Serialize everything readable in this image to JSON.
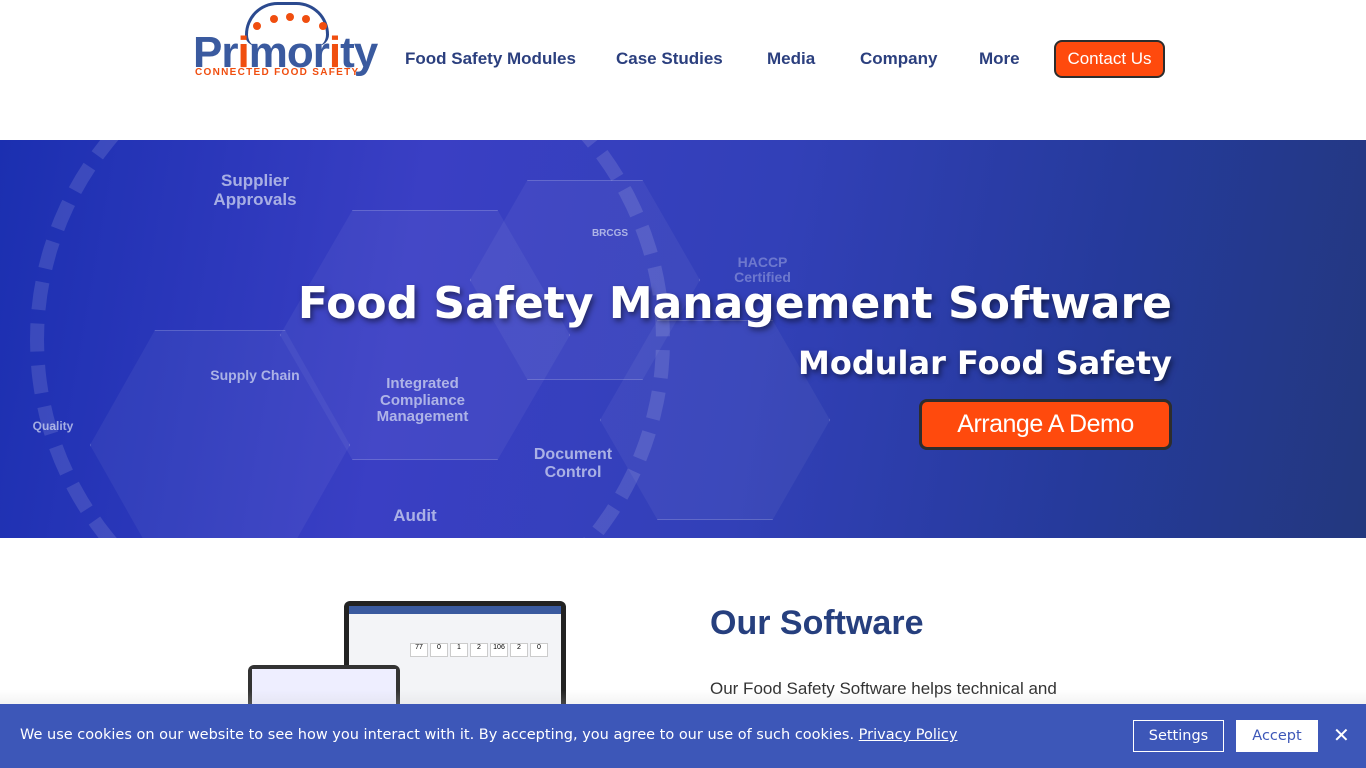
{
  "logo": {
    "word_a": "Pr",
    "word_i": "i",
    "word_b": "mor",
    "word_i2": "i",
    "word_c": "ty",
    "tagline": "CONNECTED FOOD SAFETY"
  },
  "nav": {
    "items": [
      "Food Safety Modules",
      "Case Studies",
      "Media",
      "Company",
      "More"
    ],
    "contact": "Contact Us"
  },
  "hero": {
    "title": "Food Safety Management Software",
    "subtitle": "Modular Food Safety",
    "cta": "Arrange A Demo",
    "bg_labels": [
      "Supplier Approvals",
      "Supply Chain",
      "Integrated Compliance Management",
      "Document Control",
      "Audit",
      "Quality",
      "BRCGS",
      "HACCP Certified"
    ]
  },
  "dashboard": {
    "kpis": [
      "77",
      "0",
      "1",
      "2",
      "106",
      "2",
      "0"
    ]
  },
  "section": {
    "title": "Our Software",
    "text": "Our Food Safety Software helps technical and quality teams manage and help"
  },
  "cookie": {
    "message": "We use cookies on our website to see how you interact with it. By accepting, you agree to our use of such cookies.",
    "link": "Privacy Policy",
    "settings": "Settings",
    "accept": "Accept",
    "close_icon": "close-icon"
  },
  "colors": {
    "brand_blue": "#2b3f7e",
    "accent_orange": "#ff4a0d",
    "cookie_bg": "#3d57b8"
  }
}
